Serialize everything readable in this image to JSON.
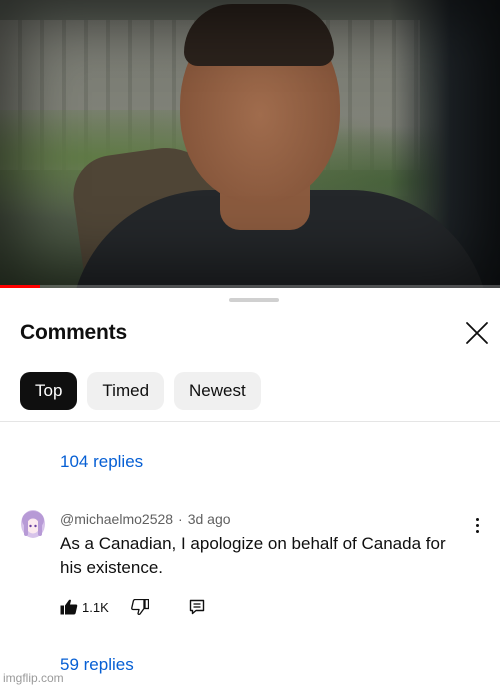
{
  "video": {
    "progress_fraction": 0.08,
    "progress_color": "#ff0000"
  },
  "comments_panel": {
    "title": "Comments",
    "close_icon": "close-icon",
    "filters": [
      {
        "label": "Top",
        "active": true
      },
      {
        "label": "Timed",
        "active": false
      },
      {
        "label": "Newest",
        "active": false
      }
    ]
  },
  "threads": [
    {
      "replies_label": "104 replies"
    },
    {
      "author": "@michaelmo2528",
      "separator": "·",
      "time": "3d ago",
      "text": "As a Canadian, I apologize on behalf of Canada for his existence.",
      "likes": "1.1K",
      "icons": [
        "thumbs-up-icon",
        "thumbs-down-icon",
        "reply-icon",
        "more-vertical-icon"
      ],
      "replies_label": "59 replies"
    }
  ],
  "colors": {
    "link": "#065fd4",
    "chip_active_bg": "#0f0f0f",
    "chip_bg": "#f0f0f0",
    "meta_text": "#606060"
  },
  "watermark": "imgflip.com"
}
